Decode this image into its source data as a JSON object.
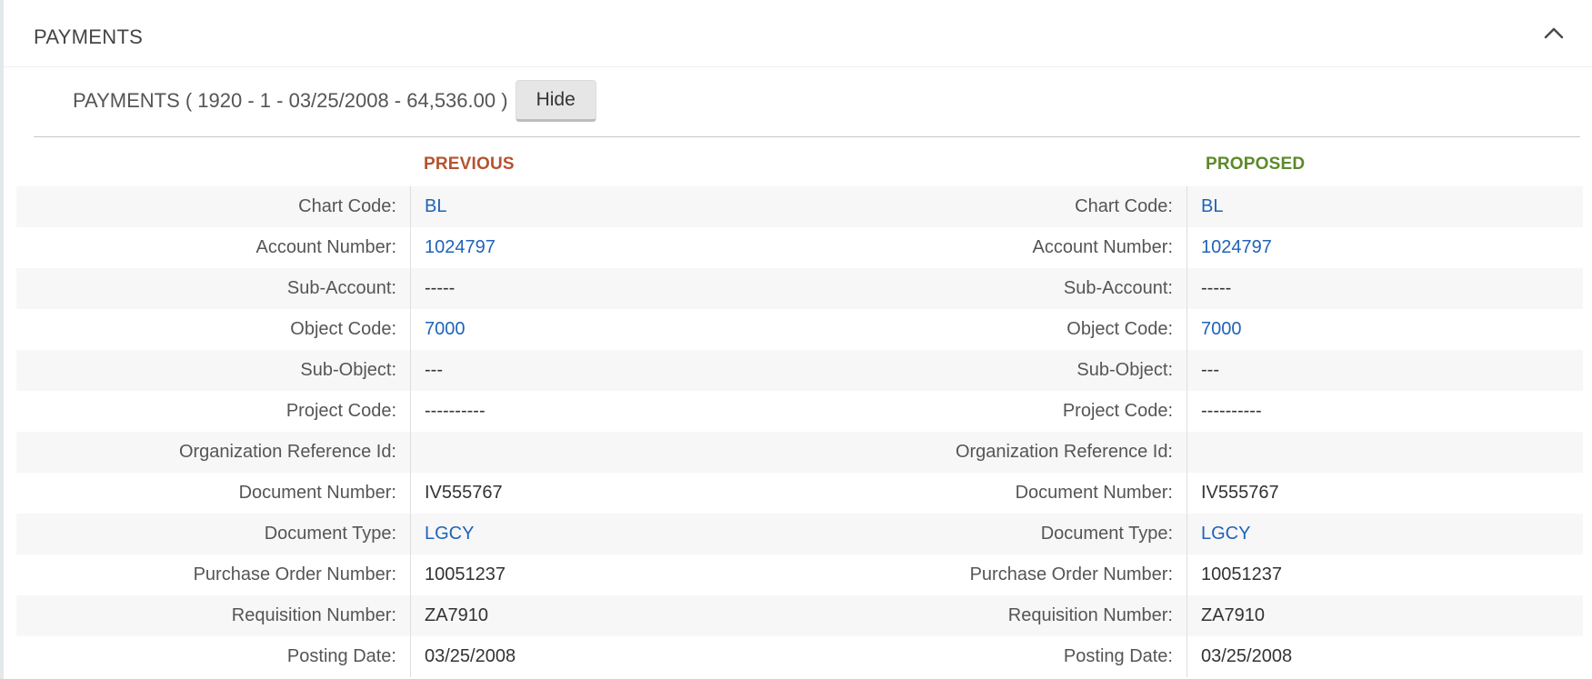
{
  "panel": {
    "title": "PAYMENTS",
    "collapse_icon": "chevron-up-icon"
  },
  "subsection": {
    "title": "PAYMENTS ( 1920 - 1 - 03/25/2008 - 64,536.00 )",
    "hide_label": "Hide"
  },
  "columns": {
    "previous": "PREVIOUS",
    "proposed": "PROPOSED"
  },
  "colors": {
    "previous_heading": "#b5532f",
    "proposed_heading": "#5b8a2a",
    "link": "#1f63b8"
  },
  "rows": [
    {
      "label": "Chart Code:",
      "previous": "BL",
      "proposed": "BL",
      "link": true
    },
    {
      "label": "Account Number:",
      "previous": "1024797",
      "proposed": "1024797",
      "link": true
    },
    {
      "label": "Sub-Account:",
      "previous": "-----",
      "proposed": "-----",
      "link": false
    },
    {
      "label": "Object Code:",
      "previous": "7000",
      "proposed": "7000",
      "link": true
    },
    {
      "label": "Sub-Object:",
      "previous": "---",
      "proposed": "---",
      "link": false
    },
    {
      "label": "Project Code:",
      "previous": "----------",
      "proposed": "----------",
      "link": false
    },
    {
      "label": "Organization Reference Id:",
      "previous": "",
      "proposed": "",
      "link": false
    },
    {
      "label": "Document Number:",
      "previous": "IV555767",
      "proposed": "IV555767",
      "link": false
    },
    {
      "label": "Document Type:",
      "previous": "LGCY",
      "proposed": "LGCY",
      "link": true
    },
    {
      "label": "Purchase Order Number:",
      "previous": "10051237",
      "proposed": "10051237",
      "link": false
    },
    {
      "label": "Requisition Number:",
      "previous": "ZA7910",
      "proposed": "ZA7910",
      "link": false
    },
    {
      "label": "Posting Date:",
      "previous": "03/25/2008",
      "proposed": "03/25/2008",
      "link": false
    }
  ]
}
